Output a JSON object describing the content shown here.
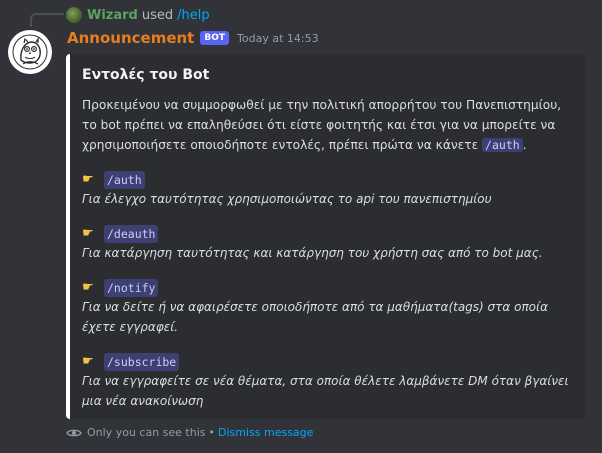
{
  "reply": {
    "user": "Wizard",
    "used_text": "used",
    "command": "/help"
  },
  "message": {
    "author": "Announcement",
    "bot_tag": "BOT",
    "timestamp": "Today at 14:53",
    "author_color": "#e67e22"
  },
  "embed": {
    "title": "Εντολές του Bot",
    "description_before": "Προκειμένου να συμμορφωθεί με την πολιτική απορρήτου του Πανεπιστημίου, το bot πρέπει να επαληθεύσει ότι είστε φοιτητής και έτσι για να μπορείτε να χρησιμοποιήσετε οποιοδήποτε εντολές, πρέπει πρώτα να κάνετε",
    "description_code": "/auth",
    "description_after": ".",
    "commands": [
      {
        "icon": "pointing-hand-icon",
        "name": "/auth",
        "description": "Για έλεγχο ταυτότητας χρησιμοποιώντας το api του πανεπιστημίου"
      },
      {
        "icon": "pointing-hand-icon",
        "name": "/deauth",
        "description": "Για κατάργηση ταυτότητας και κατάργηση του χρήστη σας από το bot μας."
      },
      {
        "icon": "pointing-hand-icon",
        "name": "/notify",
        "description": "Για να δείτε ή να αφαιρέσετε οποιοδήποτε από τα μαθήματα(tags) στα οποία έχετε εγγραφεί."
      },
      {
        "icon": "pointing-hand-icon",
        "name": "/subscribe",
        "description": "Για να εγγραφείτε σε νέα θέματα, στα οποία θέλετε λαμβάνετε DM όταν βγαίνει μια νέα ανακοίνωση"
      }
    ]
  },
  "footer": {
    "visibility_text": "Only you can see this",
    "separator": "•",
    "dismiss_text": "Dismiss message"
  },
  "colors": {
    "background": "#313338",
    "embed_background": "#2b2d31",
    "link": "#00a8fc",
    "bot_tag": "#5865f2",
    "wizard_name": "#5aa360"
  }
}
